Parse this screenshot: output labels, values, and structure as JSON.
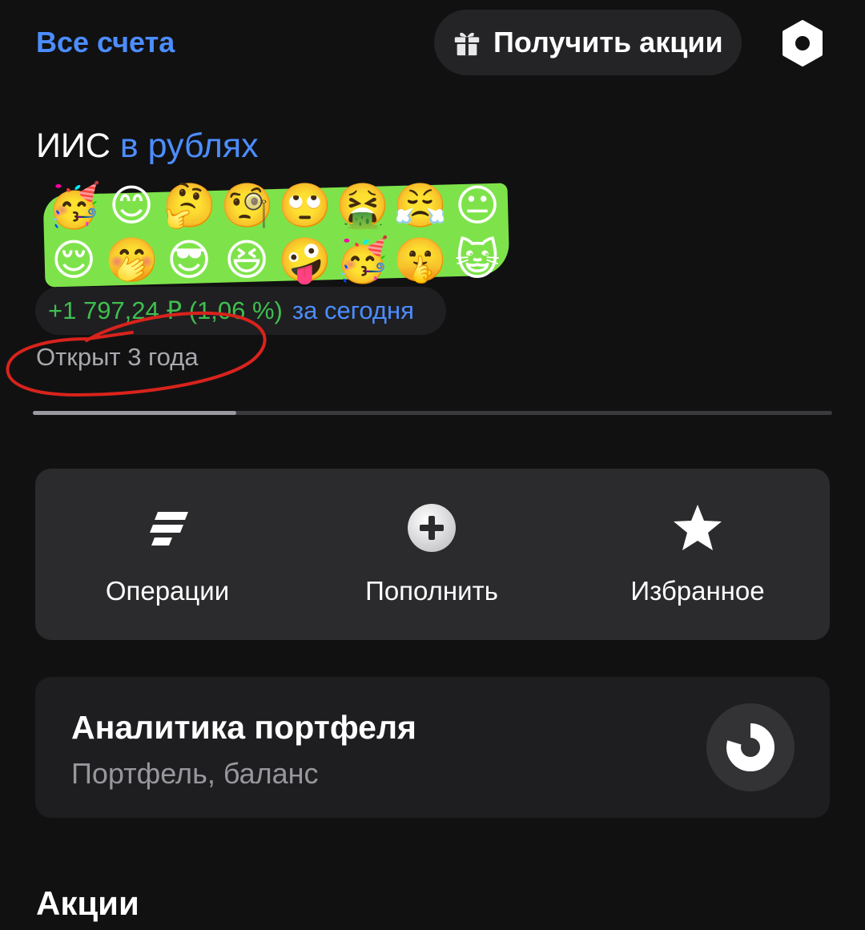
{
  "header": {
    "all_accounts": "Все счета",
    "promo_button": "Получить акции",
    "settings_icon": "hexagon-settings-icon"
  },
  "account": {
    "title_prefix": "ИИС",
    "title_currency": "в рублях",
    "balance_emojis_row1": [
      "🥳",
      "😊",
      "🤔",
      "🧐",
      "🙄",
      "🤮",
      "😤",
      "😐"
    ],
    "balance_emojis_row2": [
      "😌",
      "🤭",
      "😎",
      "😆",
      "🤪",
      "🥳",
      "🤫",
      "😺"
    ],
    "change_value": "+1 797,24 ₽ (1,06 %)",
    "change_period": "за сегодня",
    "opened_text": "Открыт 3 года"
  },
  "quick_actions": [
    {
      "label": "Операции",
      "icon": "operations-lines-icon"
    },
    {
      "label": "Пополнить",
      "icon": "plus-circle-icon"
    },
    {
      "label": "Избранное",
      "icon": "star-icon"
    }
  ],
  "analytics": {
    "title": "Аналитика портфеля",
    "subtitle": "Портфель, баланс",
    "icon": "donut-chart-icon"
  },
  "sections": {
    "stocks_title": "Акции"
  },
  "colors": {
    "accent": "#4c8dff",
    "positive": "#3fbf4f",
    "highlighter": "#7ee34a",
    "annotation_circle": "#d8231c",
    "background": "#111112"
  }
}
